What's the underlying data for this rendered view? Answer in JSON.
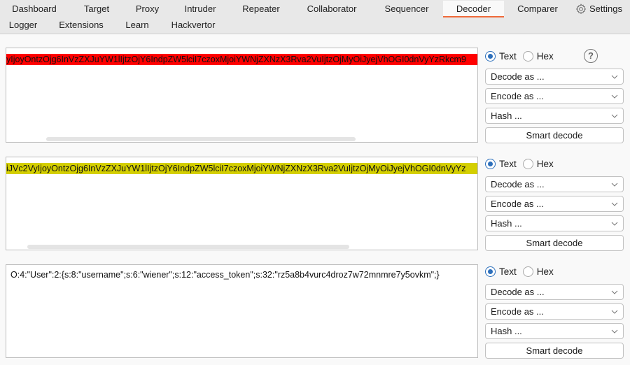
{
  "tabs": {
    "row1": [
      {
        "label": "Dashboard"
      },
      {
        "label": "Target"
      },
      {
        "label": "Proxy"
      },
      {
        "label": "Intruder"
      },
      {
        "label": "Repeater"
      },
      {
        "label": "Collaborator"
      },
      {
        "label": "Sequencer"
      },
      {
        "label": "Decoder",
        "active": true
      },
      {
        "label": "Comparer"
      },
      {
        "label": "Settings",
        "icon": "gear-icon"
      }
    ],
    "row2": [
      {
        "label": "Logger"
      },
      {
        "label": "Extensions"
      },
      {
        "label": "Learn"
      },
      {
        "label": "Hackvertor"
      }
    ]
  },
  "colors": {
    "active_tab_underline": "#ef6a3a",
    "highlight_red": "#ff0000",
    "highlight_yellow": "#d4cf00",
    "radio_selected": "#2c6fbb"
  },
  "panels": [
    {
      "content": "yIjoyOntzOjg6InVzZXJuYW1lIjtzOjY6IndpZW5lciI7czoxMjoiYWNjZXNzX3Rva2VuIjtzOjMyOiJyejVhOGI0dnVyYzRkcm9",
      "highlight": "red",
      "mode": "Text",
      "mode_options": [
        "Text",
        "Hex"
      ],
      "decode_label": "Decode as ...",
      "encode_label": "Encode as ...",
      "hash_label": "Hash ...",
      "smart_label": "Smart decode",
      "show_help": true
    },
    {
      "content": "iJVc2VyIjoyOntzOjg6InVzZXJuYW1lIjtzOjY6IndpZW5lciI7czoxMjoiYWNjZXNzX3Rva2VuIjtzOjMyOiJyejVhOGI0dnVyYz",
      "highlight": "yellow",
      "mode": "Text",
      "mode_options": [
        "Text",
        "Hex"
      ],
      "decode_label": "Decode as ...",
      "encode_label": "Encode as ...",
      "hash_label": "Hash ...",
      "smart_label": "Smart decode"
    },
    {
      "content": "O:4:\"User\":2:{s:8:\"username\";s:6:\"wiener\";s:12:\"access_token\";s:32:\"rz5a8b4vurc4droz7w72mnmre7y5ovkm\";}",
      "highlight": "none",
      "mode": "Text",
      "mode_options": [
        "Text",
        "Hex"
      ],
      "decode_label": "Decode as ...",
      "encode_label": "Encode as ...",
      "hash_label": "Hash ...",
      "smart_label": "Smart decode"
    }
  ]
}
